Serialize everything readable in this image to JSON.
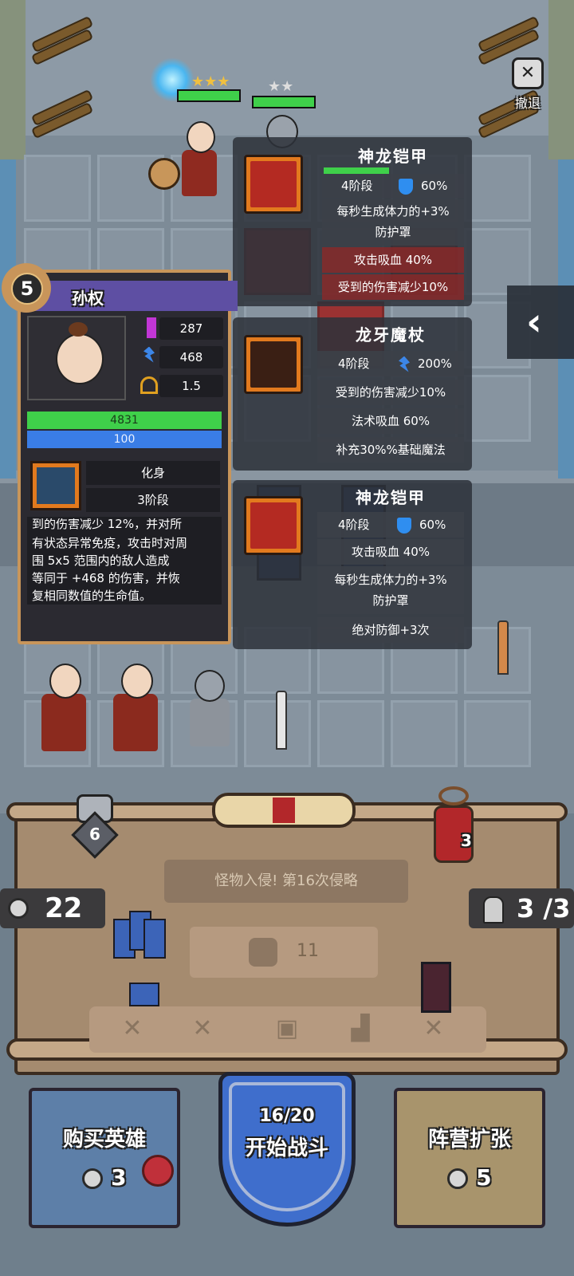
{
  "retreat": {
    "label": "撤退"
  },
  "item_panels": [
    {
      "title": "神龙铠甲",
      "stage": "4阶段",
      "stat_icon": "shield-icon",
      "stat_value": "60%",
      "effects": [
        "每秒生成体力的+3%\n防护罩",
        "攻击吸血 40%",
        "受到的伤害减少10%"
      ]
    },
    {
      "title": "龙牙魔杖",
      "stage": "4阶段",
      "stat_icon": "mana-icon",
      "stat_value": "200%",
      "effects": [
        "受到的伤害减少10%",
        "法术吸血 60%",
        "补充30%%基础魔法"
      ]
    },
    {
      "title": "神龙铠甲",
      "stage": "4阶段",
      "stat_icon": "shield-icon",
      "stat_value": "60%",
      "effects": [
        "攻击吸血 40%",
        "每秒生成体力的+3%\n防护罩",
        "绝对防御+3次"
      ]
    }
  ],
  "hero": {
    "level": "5",
    "name": "孙权",
    "stats": [
      {
        "icon": "sword-icon",
        "value": "287",
        "color": "#c236d6"
      },
      {
        "icon": "mana-icon",
        "value": "468",
        "color": "#3c86e8"
      },
      {
        "icon": "bow-icon",
        "value": "1.5",
        "color": "#e0a020"
      }
    ],
    "hp": "4831",
    "mp": "100",
    "skill": {
      "name": "化身",
      "stage": "3阶段"
    },
    "description_lines": [
      "到的伤害减少 12%，并对所",
      "有状态异常免疫，攻击时对周",
      "围 5x5 范围内的敌人造成",
      "等同于 +468 的伤害，并恢",
      "复相同数值的生命值。"
    ]
  },
  "bottom": {
    "wave_count": "6",
    "hourglass_count": "3",
    "banner_text": "怪物入侵! 第16次侵略",
    "coins": "22",
    "units": "3 /3",
    "reward": "11",
    "buy_hero": {
      "label": "购买英雄",
      "cost": "3"
    },
    "start_battle": {
      "progress": "16/20",
      "label": "开始战斗"
    },
    "expand": {
      "label": "阵营扩张",
      "cost": "5"
    }
  },
  "colors": {
    "hp_bar": "#3fd04a",
    "mp_bar": "#3a7de6",
    "accent_gold": "#c8955a",
    "name_bar": "#5e4fa3"
  }
}
